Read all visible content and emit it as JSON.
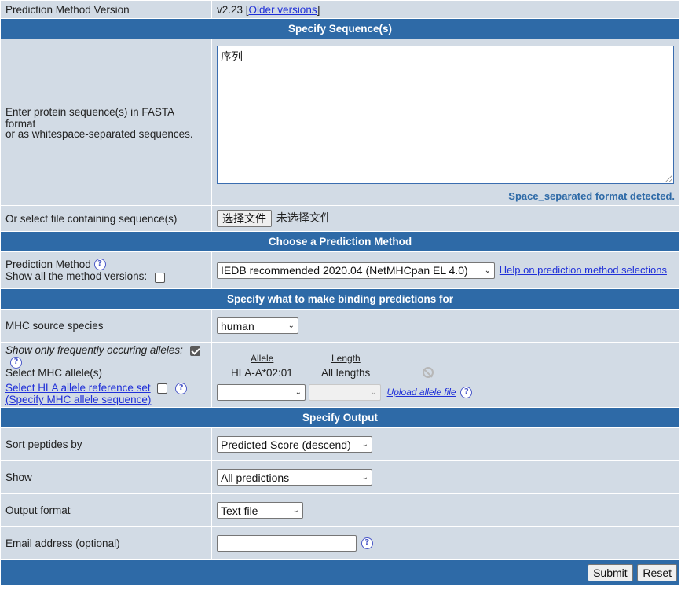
{
  "version_row": {
    "label": "Prediction Method Version",
    "version": "v2.23",
    "older_link": "Older versions"
  },
  "headers": {
    "sequences": "Specify Sequence(s)",
    "method": "Choose a Prediction Method",
    "binding": "Specify what to make binding predictions for",
    "output": "Specify Output"
  },
  "sequence": {
    "label_line1": "Enter protein sequence(s) in FASTA format",
    "label_line2": "or as whitespace-separated sequences.",
    "value": "序列",
    "detected": "Space_separated format detected."
  },
  "file": {
    "label": "Or select file containing sequence(s)",
    "button": "选择文件",
    "status": "未选择文件"
  },
  "method": {
    "label": "Prediction Method",
    "show_versions_label": "Show all the method versions:",
    "selected": "IEDB recommended 2020.04 (NetMHCpan EL 4.0)",
    "help_link": "Help on prediction method selections"
  },
  "species": {
    "label": "MHC source species",
    "selected": "human"
  },
  "allele": {
    "frequent_label": "Show only frequently occuring alleles:",
    "select_label": "Select MHC allele(s)",
    "hla_ref_link": "Select HLA allele reference set",
    "specify_seq_link": "(Specify MHC allele sequence)",
    "col_allele": "Allele",
    "col_length": "Length",
    "row_allele": "HLA-A*02:01",
    "row_length": "All lengths",
    "upload_link": "Upload allele file"
  },
  "sort": {
    "label": "Sort peptides by",
    "selected": "Predicted Score (descend)"
  },
  "show": {
    "label": "Show",
    "selected": "All predictions"
  },
  "output_format": {
    "label": "Output format",
    "selected": "Text file"
  },
  "email": {
    "label": "Email address (optional)",
    "value": ""
  },
  "actions": {
    "submit": "Submit",
    "reset": "Reset"
  },
  "colors": {
    "header_bg": "#2e6aa7",
    "cell_bg": "#d2dbe5",
    "link": "#1f2fd8"
  }
}
